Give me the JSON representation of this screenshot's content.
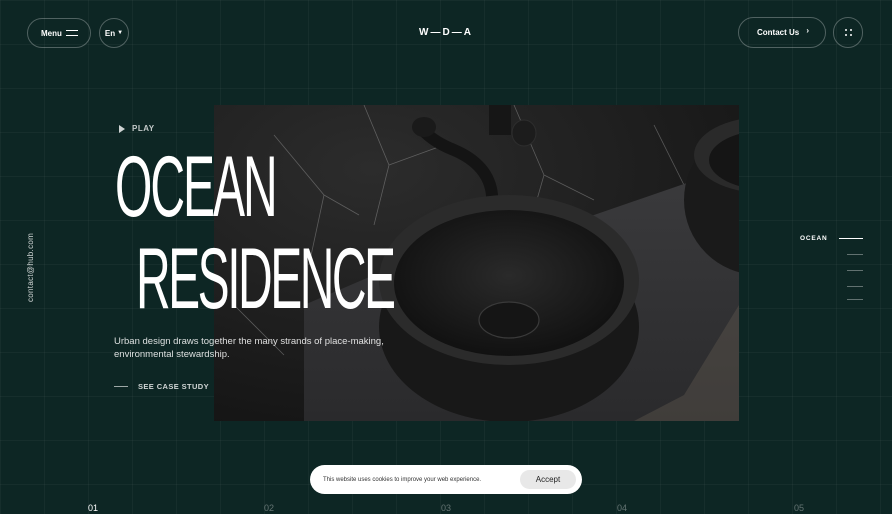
{
  "header": {
    "menu_label": "Menu",
    "lang_label": "En",
    "logo": "W—D—A",
    "contact_label": "Contact Us"
  },
  "side": {
    "email": "contact@hub.com"
  },
  "hero": {
    "play_label": "PLAY",
    "title_line1": "OCEAN",
    "title_line2": "RESIDENCE",
    "description": "Urban design draws together the many strands of place-making, environmental stewardship.",
    "cta_label": "SEE CASE STUDY"
  },
  "right_nav": {
    "active_label": "OCEAN"
  },
  "cookie": {
    "text": "This website uses cookies to improve your web experience.",
    "accept_label": "Accept"
  },
  "slides": [
    "01",
    "02",
    "03",
    "04",
    "05"
  ],
  "active_slide": "01",
  "colors": {
    "background": "#0d2624",
    "text": "#ffffff",
    "cookie_bg": "#ffffff"
  }
}
